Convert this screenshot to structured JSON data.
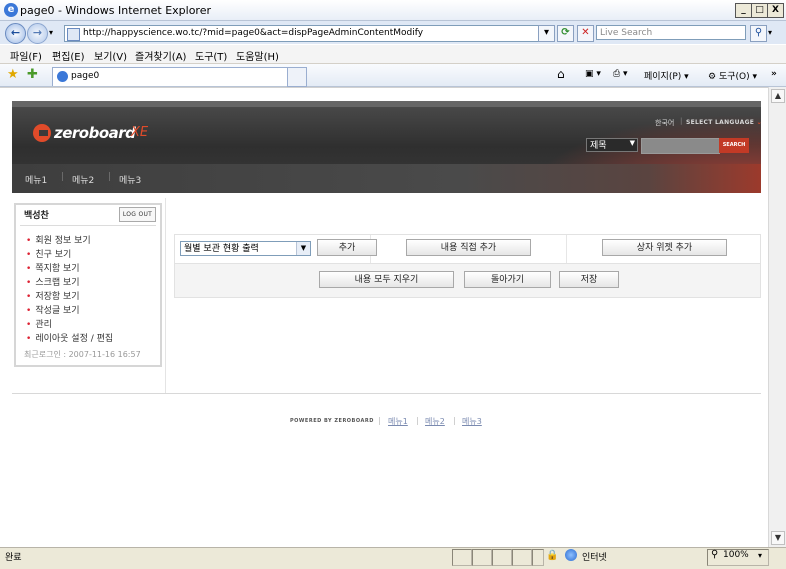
{
  "window": {
    "title": "page0 - Windows Internet Explorer",
    "min": "_",
    "max": "□",
    "close": "X"
  },
  "address": {
    "url": "http://happyscience.wo.tc/?mid=page0&act=dispPageAdminContentModify",
    "search_placeholder": "Live Search"
  },
  "menu": [
    "파일(F)",
    "편집(E)",
    "보기(V)",
    "즐겨찾기(A)",
    "도구(T)",
    "도움말(H)"
  ],
  "tab": {
    "label": "page0"
  },
  "commandbar": {
    "page": "페이지(P)",
    "tools": "도구(O)"
  },
  "site": {
    "logo": "zeroboard",
    "logo_suffix": "XE",
    "language_current": "한국어",
    "language_select": "SELECT LANGUAGE",
    "search_type": "제목",
    "search_button": "SEARCH",
    "nav": [
      "메뉴1",
      "메뉴2",
      "메뉴3"
    ]
  },
  "login": {
    "user": "백성찬",
    "logout": "LOG OUT",
    "items": [
      "회원 정보 보기",
      "친구 보기",
      "쪽지함 보기",
      "스크랩 보기",
      "저장함 보기",
      "작성글 보기",
      "관리",
      "레이아웃 설정 / 편집"
    ],
    "last_login_label": "최근로그인 :",
    "last_login_value": "2007-11-16 16:57"
  },
  "editor": {
    "widget_select": "월별 보관 현황 출력",
    "add": "추가",
    "add_content": "내용 직접 추가",
    "add_box_widget": "상자 위젯 추가",
    "clear_all": "내용 모두 지우기",
    "back": "돌아가기",
    "save": "저장"
  },
  "footer": {
    "powered": "POWERED BY ZEROBOARD",
    "links": [
      "메뉴1",
      "메뉴2",
      "메뉴3"
    ]
  },
  "status": {
    "text": "완료",
    "zone": "인터넷",
    "zoom": "100%"
  }
}
